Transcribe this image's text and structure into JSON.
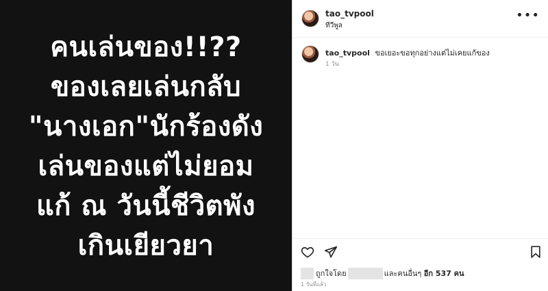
{
  "media": {
    "lines": [
      "คนเล่นของ!!??",
      "ของเลยเล่นกลับ",
      "\"นางเอก\"นักร้องดัง",
      "เล่นของแต่ไม่ยอม",
      "แก้ ณ วันนี้ชีวิตพัง",
      "เกินเยียวยา"
    ]
  },
  "header": {
    "username": "tao_tvpool",
    "subtitle": "ทีวีพูล",
    "more": "•••"
  },
  "caption": {
    "username": "tao_tvpool",
    "text": "ขอเยอะขอทุกอย่างแต่ไม่เคยแก้ของ",
    "time": "1 วัน"
  },
  "likes": {
    "prefix": "ถูกใจโดย",
    "middle": "และคนอื่นๆ",
    "count": "อีก 537 คน"
  },
  "post_time": "1 วันที่แล้ว",
  "icons": [
    "more-options-icon",
    "heart-icon",
    "share-icon",
    "bookmark-icon"
  ]
}
